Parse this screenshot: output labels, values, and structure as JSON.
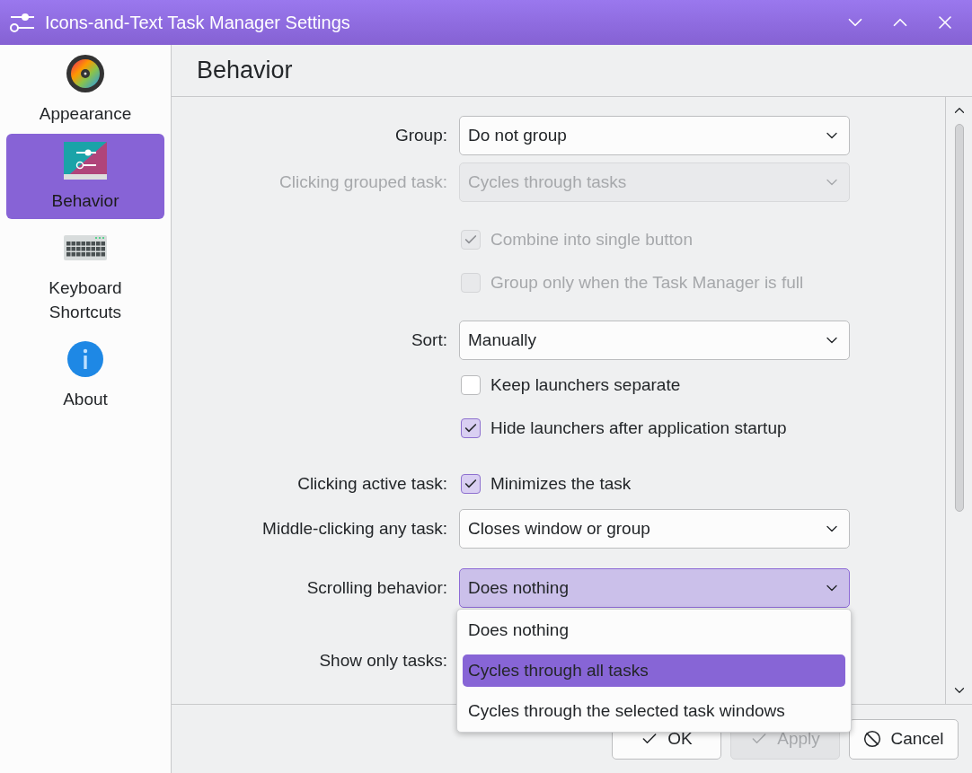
{
  "window": {
    "title": "Icons-and-Text Task Manager Settings"
  },
  "sidebar": {
    "items": [
      {
        "label": "Appearance",
        "selected": false
      },
      {
        "label": "Behavior",
        "selected": true
      },
      {
        "label": "Keyboard Shortcuts",
        "selected": false
      },
      {
        "label": "About",
        "selected": false
      }
    ]
  },
  "page": {
    "title": "Behavior"
  },
  "form": {
    "sections": [
      [
        {
          "kind": "combo",
          "label": "Group:",
          "value": "Do not group",
          "disabled": false,
          "open": false
        },
        {
          "kind": "combo",
          "label": "Clicking grouped task:",
          "value": "Cycles through tasks",
          "disabled": true,
          "open": false
        }
      ],
      [
        {
          "kind": "checkbox",
          "text": "Combine into single button",
          "checked": true,
          "disabled": true
        },
        {
          "kind": "checkbox",
          "text": "Group only when the Task Manager is full",
          "checked": false,
          "disabled": true
        }
      ],
      [
        {
          "kind": "combo",
          "label": "Sort:",
          "value": "Manually",
          "disabled": false,
          "open": false
        },
        {
          "kind": "checkbox",
          "text": "Keep launchers separate",
          "checked": false,
          "disabled": false
        },
        {
          "kind": "checkbox",
          "text": "Hide launchers after application startup",
          "checked": true,
          "disabled": false
        }
      ],
      [
        {
          "kind": "checkbox",
          "label": "Clicking active task:",
          "text": "Minimizes the task",
          "checked": true,
          "disabled": false
        },
        {
          "kind": "combo",
          "label": "Middle-clicking any task:",
          "value": "Closes window or group",
          "disabled": false,
          "open": false
        }
      ],
      [
        {
          "kind": "combo",
          "label": "Scrolling behavior:",
          "value": "Does nothing",
          "disabled": false,
          "open": true,
          "options": [
            {
              "text": "Does nothing",
              "highlighted": false
            },
            {
              "text": "Cycles through all tasks",
              "highlighted": true
            },
            {
              "text": "Cycles through the selected task windows",
              "highlighted": false
            }
          ]
        }
      ],
      [
        {
          "kind": "label",
          "label": "Show only tasks:"
        }
      ]
    ]
  },
  "buttons": [
    {
      "kind": "ok",
      "label": "OK",
      "disabled": false
    },
    {
      "kind": "apply",
      "label": "Apply",
      "disabled": true
    },
    {
      "kind": "cancel",
      "label": "Cancel",
      "disabled": false
    }
  ]
}
